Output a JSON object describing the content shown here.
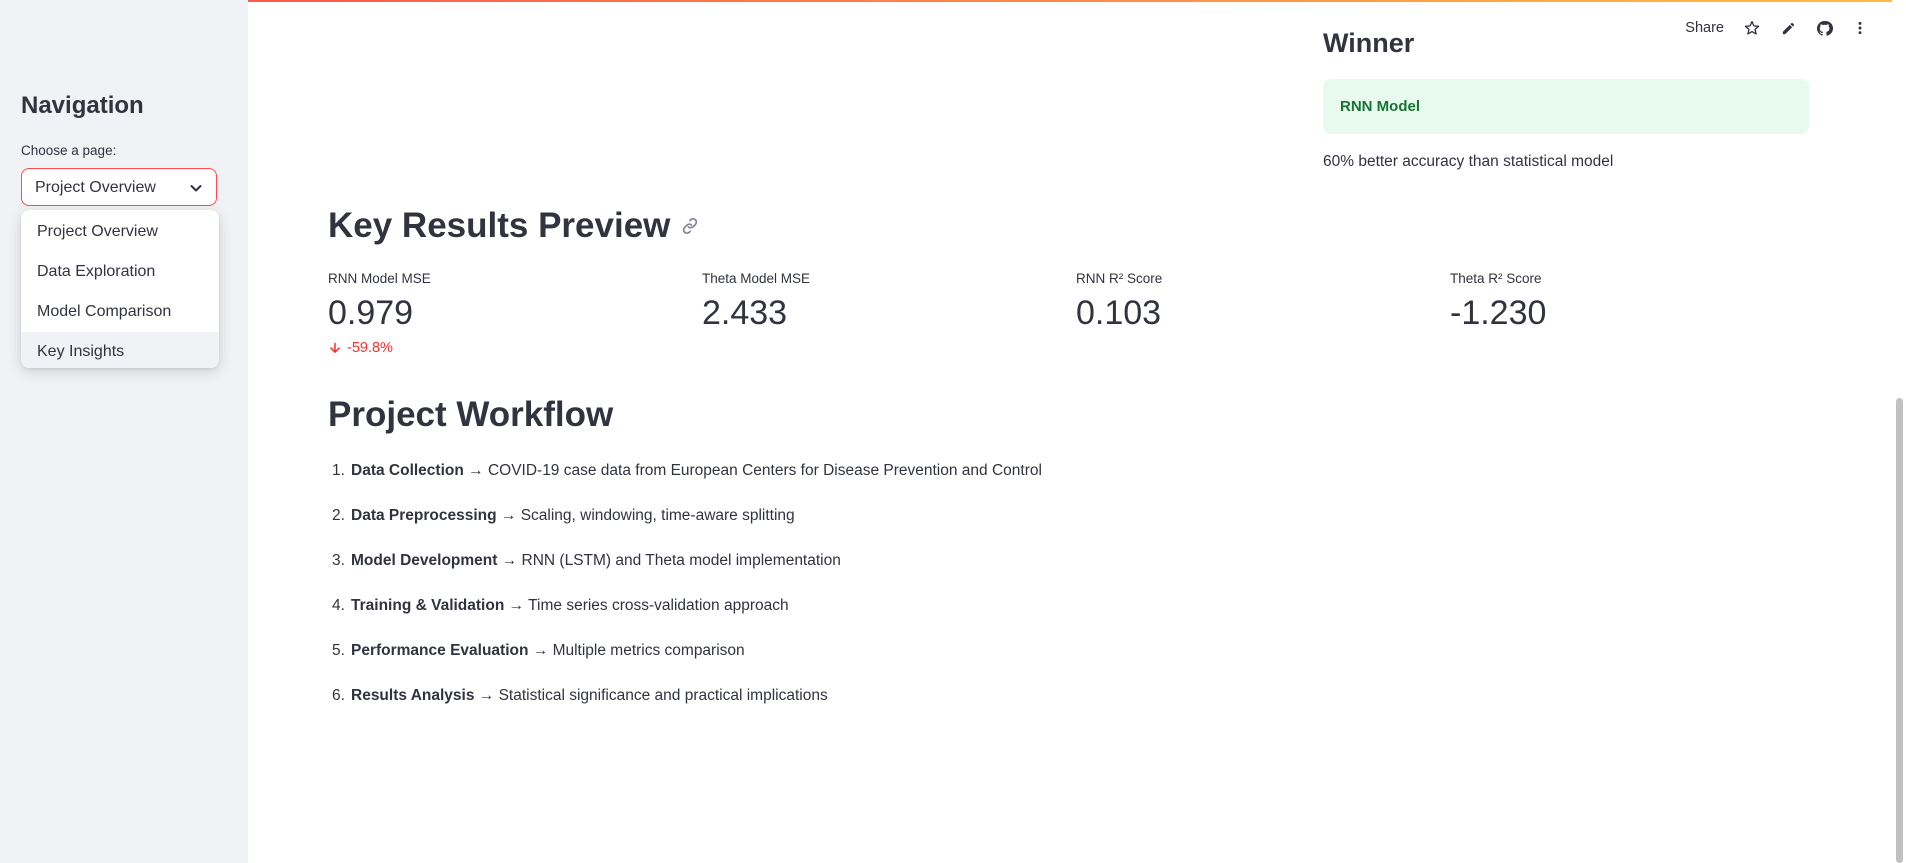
{
  "sidebar": {
    "title": "Navigation",
    "select_label": "Choose a page:",
    "selected": "Project Overview",
    "options": [
      "Project Overview",
      "Data Exploration",
      "Model Comparison",
      "Key Insights"
    ]
  },
  "toolbar": {
    "share_label": "Share",
    "icons": [
      "star-icon",
      "edit-icon",
      "github-icon",
      "more-vert-icon"
    ]
  },
  "winner": {
    "title": "Winner",
    "model": "RNN Model",
    "note": "60% better accuracy than statistical model"
  },
  "key_results": {
    "title": "Key Results Preview",
    "metrics": [
      {
        "label": "RNN Model MSE",
        "value": "0.979",
        "delta": "-59.8%"
      },
      {
        "label": "Theta Model MSE",
        "value": "2.433"
      },
      {
        "label": "RNN R² Score",
        "value": "0.103"
      },
      {
        "label": "Theta R² Score",
        "value": "-1.230"
      }
    ]
  },
  "workflow": {
    "title": "Project Workflow",
    "steps": [
      {
        "num": "1.",
        "name": "Data Collection",
        "desc": " → COVID-19 case data from European Centers for Disease Prevention and Control"
      },
      {
        "num": "2.",
        "name": "Data Preprocessing",
        "desc": " → Scaling, windowing, time-aware splitting"
      },
      {
        "num": "3.",
        "name": "Model Development",
        "desc": " → RNN (LSTM) and Theta model implementation"
      },
      {
        "num": "4.",
        "name": "Training & Validation",
        "desc": " → Time series cross-validation approach"
      },
      {
        "num": "5.",
        "name": "Performance Evaluation",
        "desc": " → Multiple metrics comparison"
      },
      {
        "num": "6.",
        "name": "Results Analysis",
        "desc": " → Statistical significance and practical implications"
      }
    ]
  },
  "colors": {
    "accent": "#ff4b4b",
    "success_bg": "#e8f9ee",
    "success_text": "#177233",
    "delta_negative": "#ff2b2b",
    "sidebar_bg": "#f0f2f6"
  }
}
